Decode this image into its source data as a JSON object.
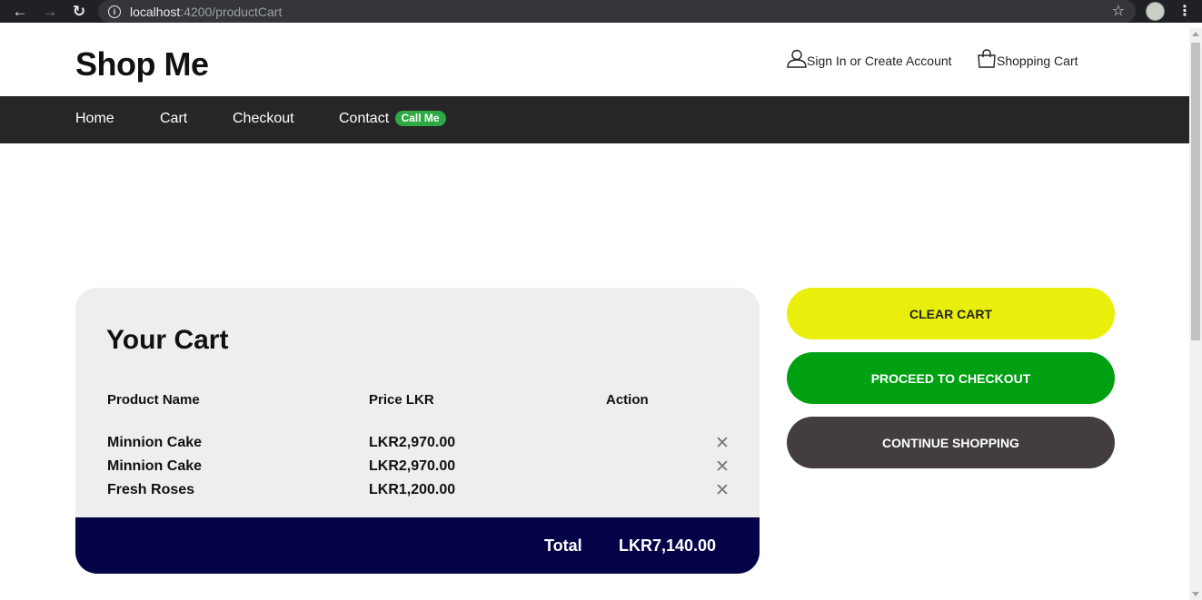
{
  "browser": {
    "url_host": "localhost",
    "url_rest": ":4200/productCart",
    "back_icon": "←",
    "forward_icon": "→",
    "reload_icon": "↻",
    "star_icon": "☆",
    "menu_icon": "⋮"
  },
  "header": {
    "brand": "Shop Me",
    "account_link": "Sign In or Create Account",
    "cart_link": "Shopping Cart"
  },
  "nav": {
    "items": [
      "Home",
      "Cart",
      "Checkout",
      "Contact"
    ],
    "contact_badge": "Call Me"
  },
  "cart": {
    "title": "Your Cart",
    "columns": [
      "Product Name",
      "Price LKR",
      "Action"
    ],
    "rows": [
      {
        "name": "Minnion Cake",
        "price": "LKR2,970.00",
        "action": "✕"
      },
      {
        "name": "Minnion Cake",
        "price": "LKR2,970.00",
        "action": "✕"
      },
      {
        "name": "Fresh Roses",
        "price": "LKR1,200.00",
        "action": "✕"
      }
    ],
    "total_label": "Total",
    "total_value": "LKR7,140.00"
  },
  "actions": {
    "clear": "CLEAR CART",
    "checkout": "PROCEED TO CHECKOUT",
    "continue": "CONTINUE SHOPPING"
  },
  "colors": {
    "navbar": "#262626",
    "badge": "#2eaa44",
    "total_bar": "#050347",
    "clear_button": "#e9ef0b",
    "checkout_button": "#00a013",
    "continue_button": "#433d3d",
    "card_background": "#eeeeee"
  }
}
